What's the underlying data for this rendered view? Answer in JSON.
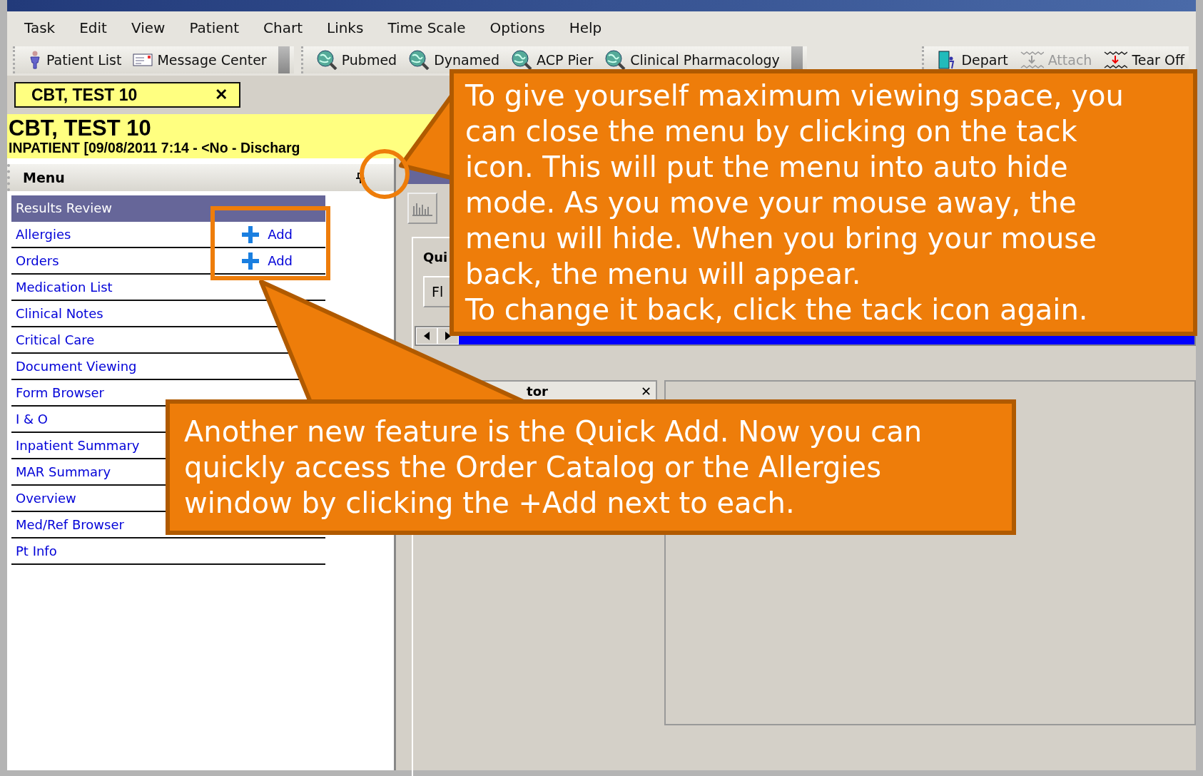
{
  "menubar": [
    "Task",
    "Edit",
    "View",
    "Patient",
    "Chart",
    "Links",
    "Time Scale",
    "Options",
    "Help"
  ],
  "toolbar_groups": [
    {
      "items": [
        {
          "kind": "person",
          "label": "Patient List",
          "disabled": false
        },
        {
          "kind": "envelope",
          "label": "Message Center",
          "disabled": false
        }
      ]
    },
    {
      "items": [
        {
          "kind": "globe",
          "label": "Pubmed",
          "disabled": false
        },
        {
          "kind": "globe",
          "label": "Dynamed",
          "disabled": false
        },
        {
          "kind": "globe",
          "label": "ACP Pier",
          "disabled": false
        },
        {
          "kind": "globe",
          "label": "Clinical Pharmacology",
          "disabled": false
        }
      ]
    },
    {
      "items": [
        {
          "kind": "door",
          "label": "Depart",
          "disabled": false
        },
        {
          "kind": "tear",
          "label": "Attach",
          "disabled": true
        },
        {
          "kind": "tear",
          "label": "Tear Off",
          "disabled": false
        }
      ]
    }
  ],
  "patient_tab": {
    "label": "CBT, TEST 10",
    "close": "✕"
  },
  "banner": {
    "name": "CBT, TEST 10",
    "encounter": "INPATIENT [09/08/2011 7:14 - <No - Discharg"
  },
  "menu": {
    "title": "Menu",
    "items": [
      {
        "label": "Results Review",
        "selected": true
      },
      {
        "label": "Allergies",
        "selected": false,
        "quick_add": "Add"
      },
      {
        "label": "Orders",
        "selected": false,
        "quick_add": "Add"
      },
      {
        "label": "Medication List",
        "selected": false
      },
      {
        "label": "Clinical Notes",
        "selected": false
      },
      {
        "label": "Critical Care",
        "selected": false
      },
      {
        "label": "Document Viewing",
        "selected": false
      },
      {
        "label": "Form Browser",
        "selected": false
      },
      {
        "label": "I & O",
        "selected": false
      },
      {
        "label": "Inpatient Summary",
        "selected": false
      },
      {
        "label": "MAR Summary",
        "selected": false
      },
      {
        "label": "Overview",
        "selected": false
      },
      {
        "label": "Med/Ref Browser",
        "selected": false
      },
      {
        "label": "Pt Info",
        "selected": false
      }
    ]
  },
  "content": {
    "tab_fragment": "Qui",
    "field_fragment": "Fl",
    "panel_fragment": "tor",
    "panel_close": "✕"
  },
  "callouts": [
    {
      "paragraphs": [
        "To give yourself maximum viewing space, you can close the menu by clicking on the tack icon. This will put the menu into auto hide mode. As you move your mouse away, the menu will hide. When you bring your mouse back, the menu will appear.",
        "To change it back, click the tack icon again."
      ]
    },
    {
      "paragraphs": [
        "Another new feature is the Quick Add. Now you can quickly access the Order Catalog or the Allergies window by clicking the +Add next to each."
      ]
    }
  ]
}
